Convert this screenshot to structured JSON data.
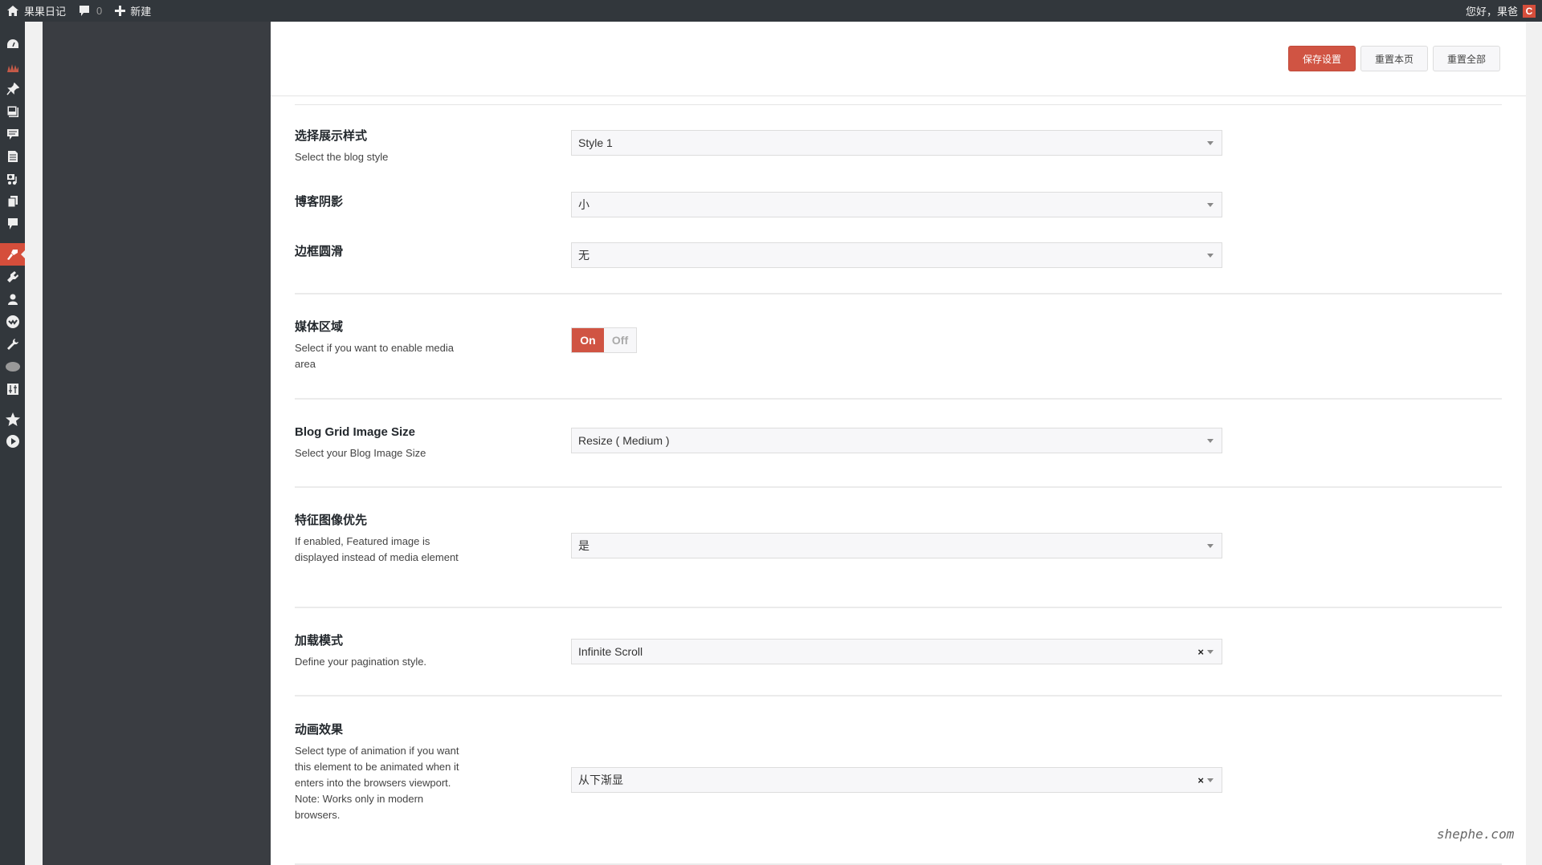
{
  "adminbar": {
    "site_name": "果果日记",
    "comments_count": "0",
    "new_label": "新建",
    "greeting": "您好，果爸",
    "avatar_letter": "C"
  },
  "adminmenu": {
    "icons": [
      {
        "name": "dashboard-icon"
      },
      {
        "name": "stats-icon"
      },
      {
        "name": "posts-pin-icon"
      },
      {
        "name": "media-gallery-icon"
      },
      {
        "name": "comments-list-icon"
      },
      {
        "name": "pages-icon"
      },
      {
        "name": "media-library-icon"
      },
      {
        "name": "copies-icon"
      },
      {
        "name": "feedback-icon"
      },
      {
        "name": "appearance-brush-icon",
        "active": true
      },
      {
        "name": "plugins-icon"
      },
      {
        "name": "users-icon"
      },
      {
        "name": "badge-check-icon"
      },
      {
        "name": "tools-wrench-icon"
      },
      {
        "name": "cloud-icon"
      },
      {
        "name": "settings-sliders-icon"
      },
      {
        "name": "star-icon"
      },
      {
        "name": "play-icon"
      }
    ]
  },
  "header": {
    "save_label": "保存设置",
    "reset_page_label": "重置本页",
    "reset_all_label": "重置全部"
  },
  "colors": {
    "accent": "#d05443",
    "adminbar": "#32373c"
  },
  "settings": {
    "blog_style": {
      "title": "选择展示样式",
      "desc": "Select the blog style",
      "value": "Style 1"
    },
    "blog_shadow": {
      "title": "博客阴影",
      "value": "小"
    },
    "border_radius": {
      "title": "边框圆滑",
      "value": "无"
    },
    "media_area": {
      "title": "媒体区域",
      "desc": "Select if you want to enable media area",
      "on_label": "On",
      "off_label": "Off",
      "state": "On"
    },
    "grid_image_size": {
      "title": "Blog Grid Image Size",
      "desc": "Select your Blog Image Size",
      "value": "Resize ( Medium )"
    },
    "featured_priority": {
      "title": "特征图像优先",
      "desc": "If enabled, Featured image is displayed instead of media element",
      "value": "是"
    },
    "pagination": {
      "title": "加载模式",
      "desc": "Define your pagination style.",
      "value": "Infinite Scroll",
      "clear": "×"
    },
    "animation": {
      "title": "动画效果",
      "desc": "Select type of animation if you want this element to be animated when it enters into the browsers viewport. Note: Works only in modern browsers.",
      "value": "从下渐显",
      "clear": "×"
    }
  },
  "watermark": "shephe.com"
}
